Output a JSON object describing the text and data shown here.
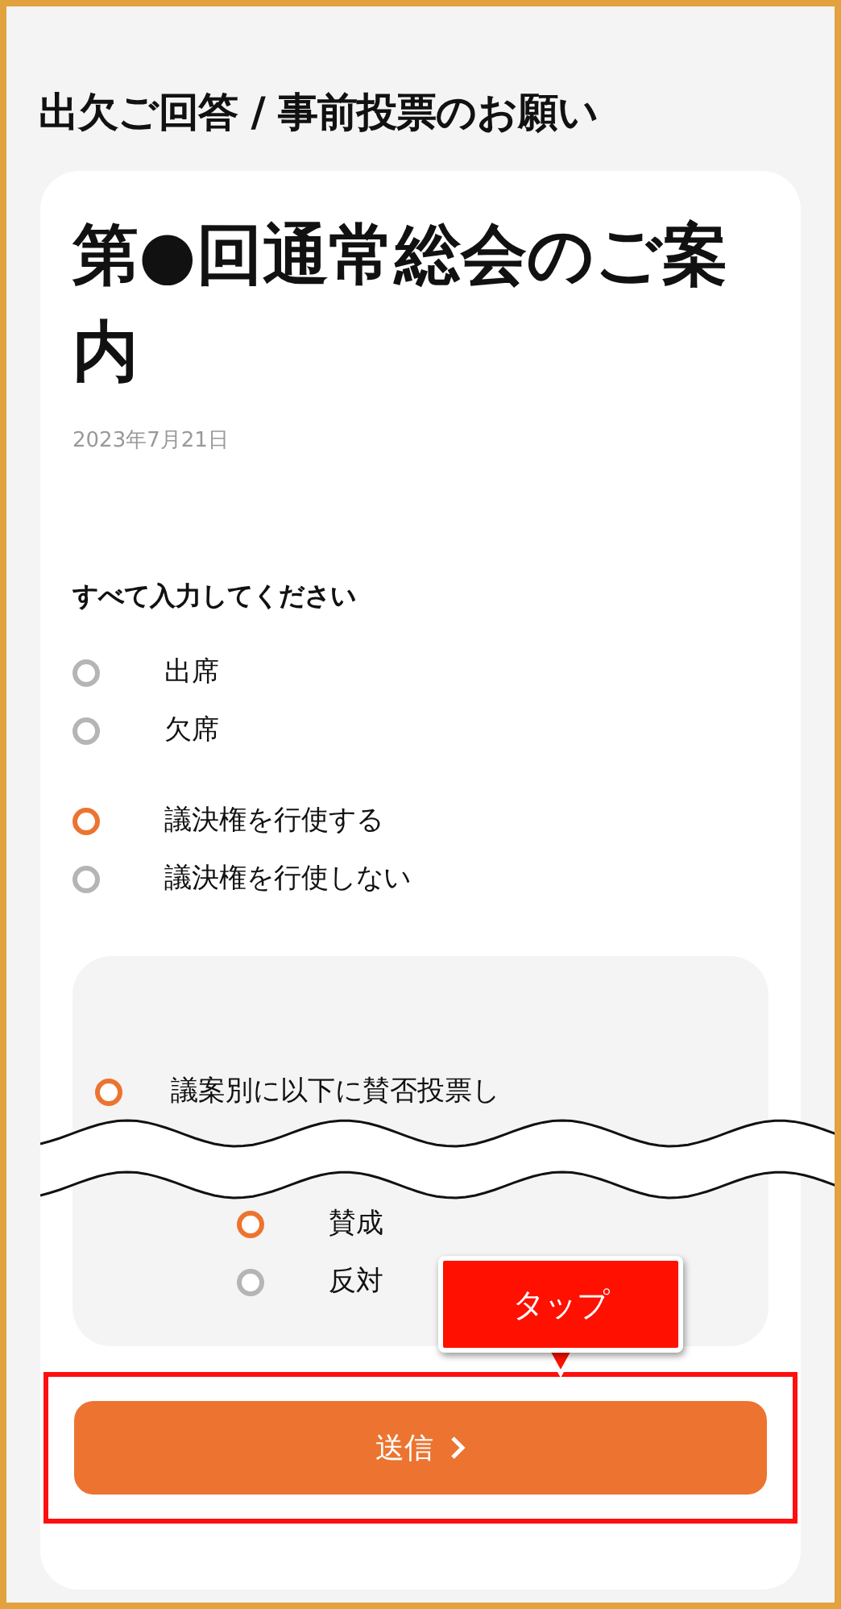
{
  "page_title": "出欠ご回答 / 事前投票のお願い",
  "notice": {
    "title": "第●回通常総会のご案内",
    "date": "2023年7月21日",
    "instruction": "すべて入力してください",
    "attendance": [
      {
        "label": "出席",
        "selected": false
      },
      {
        "label": "欠席",
        "selected": false
      }
    ],
    "voting": [
      {
        "label": "議決権を行使する",
        "selected": true
      },
      {
        "label": "議決権を行使しない",
        "selected": false
      }
    ],
    "vote_method": {
      "label": "議案別に以下に賛否投票し",
      "selected": true
    },
    "vote_choices": [
      {
        "label": "賛成",
        "selected": true
      },
      {
        "label": "反対",
        "selected": false
      }
    ]
  },
  "submit_button": {
    "label": "送信"
  },
  "callout": {
    "label": "タップ"
  }
}
